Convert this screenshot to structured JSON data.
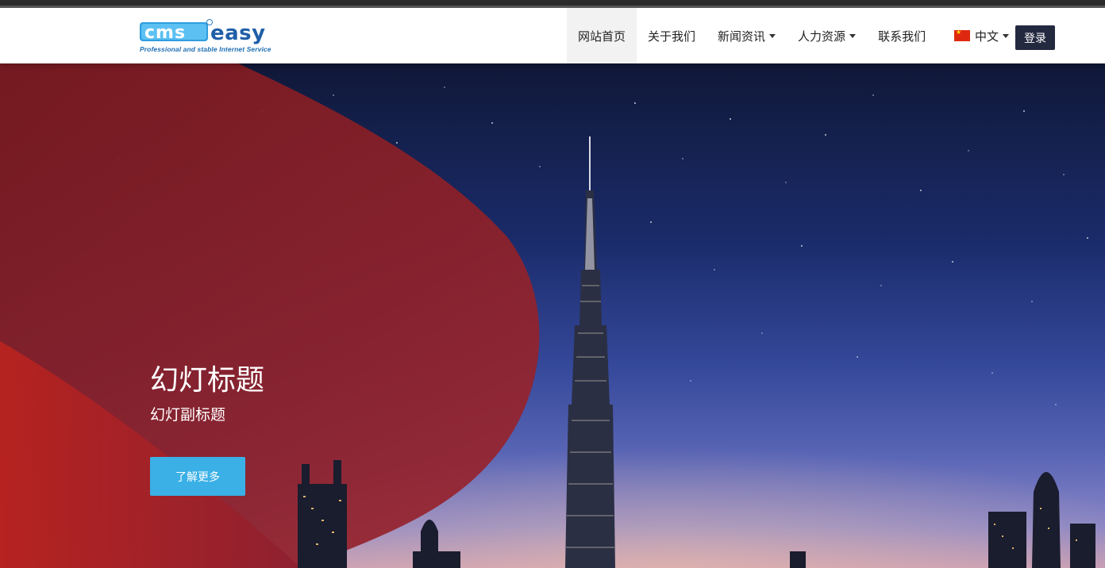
{
  "logo": {
    "wordmark": "cmseasy",
    "tagline": "Professional and stable Internet Service"
  },
  "nav": {
    "items": [
      {
        "label": "网站首页",
        "active": true,
        "dropdown": false
      },
      {
        "label": "关于我们",
        "active": false,
        "dropdown": false
      },
      {
        "label": "新闻资讯",
        "active": false,
        "dropdown": true
      },
      {
        "label": "人力资源",
        "active": false,
        "dropdown": true
      },
      {
        "label": "联系我们",
        "active": false,
        "dropdown": false
      }
    ],
    "language": {
      "label": "中文",
      "flag": "china-flag-icon"
    },
    "login_label": "登录"
  },
  "hero": {
    "title": "幻灯标题",
    "subtitle": "幻灯副标题",
    "button_label": "了解更多",
    "accent_color": "#c0282d",
    "button_color": "#3ab0e6"
  }
}
